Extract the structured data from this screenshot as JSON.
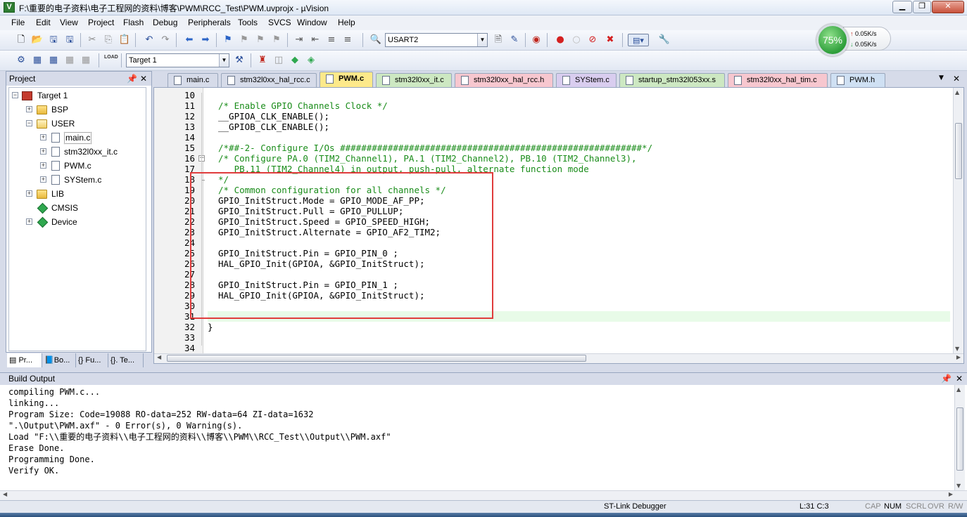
{
  "window": {
    "title": "F:\\重要的电子资料\\电子工程网的资料\\博客\\PWM\\RCC_Test\\PWM.uvprojx - µVision",
    "app_icon": "V"
  },
  "menu": [
    "File",
    "Edit",
    "View",
    "Project",
    "Flash",
    "Debug",
    "Peripherals",
    "Tools",
    "SVCS",
    "Window",
    "Help"
  ],
  "toolbar": {
    "uart_combo": "USART2",
    "target_combo": "Target 1",
    "load_label": "LOAD"
  },
  "net_meter": {
    "percent": "75%",
    "up": "0.05K/s",
    "down": "0.05K/s"
  },
  "project_panel": {
    "title": "Project",
    "tree": [
      {
        "label": "Target 1"
      },
      {
        "label": "BSP"
      },
      {
        "label": "USER"
      },
      {
        "label": "main.c"
      },
      {
        "label": "stm32l0xx_it.c"
      },
      {
        "label": "PWM.c"
      },
      {
        "label": "SYStem.c"
      },
      {
        "label": "LIB"
      },
      {
        "label": "CMSIS"
      },
      {
        "label": "Device"
      }
    ],
    "bottom_tabs": [
      "Pr...",
      "Bo...",
      "{} Fu...",
      "{}. Te..."
    ]
  },
  "editor_tabs": [
    {
      "label": "main.c",
      "color": "#d6dbe9"
    },
    {
      "label": "stm32l0xx_hal_rcc.c",
      "color": "#d6dbe9"
    },
    {
      "label": "PWM.c",
      "color": "#fde98a"
    },
    {
      "label": "stm32l0xx_it.c",
      "color": "#cde8c2"
    },
    {
      "label": "stm32l0xx_hal_rcc.h",
      "color": "#f7c7cf"
    },
    {
      "label": "SYStem.c",
      "color": "#d9cdef"
    },
    {
      "label": "startup_stm32l053xx.s",
      "color": "#cde8c2"
    },
    {
      "label": "stm32l0xx_hal_tim.c",
      "color": "#f7c7cf"
    },
    {
      "label": "PWM.h",
      "color": "#cfe0f3"
    }
  ],
  "code_lines": [
    {
      "n": "10",
      "text": ""
    },
    {
      "n": "11",
      "text": "/* Enable GPIO Channels Clock */"
    },
    {
      "n": "12",
      "text": "__GPIOA_CLK_ENABLE();"
    },
    {
      "n": "13",
      "text": "__GPIOB_CLK_ENABLE();"
    },
    {
      "n": "14",
      "text": ""
    },
    {
      "n": "15",
      "text": "/*##-2- Configure I/Os #########################################################*/"
    },
    {
      "n": "16",
      "text": "/* Configure PA.0 (TIM2_Channel1), PA.1 (TIM2_Channel2), PB.10 (TIM2_Channel3),"
    },
    {
      "n": "17",
      "text": "   PB.11 (TIM2_Channel4) in output, push-pull, alternate function mode"
    },
    {
      "n": "18",
      "text": "*/"
    },
    {
      "n": "19",
      "text": "/* Common configuration for all channels */"
    },
    {
      "n": "20",
      "text": "GPIO_InitStruct.Mode = GPIO_MODE_AF_PP;"
    },
    {
      "n": "21",
      "text": "GPIO_InitStruct.Pull = GPIO_PULLUP;"
    },
    {
      "n": "22",
      "text": "GPIO_InitStruct.Speed = GPIO_SPEED_HIGH;"
    },
    {
      "n": "23",
      "text": "GPIO_InitStruct.Alternate = GPIO_AF2_TIM2;"
    },
    {
      "n": "24",
      "text": ""
    },
    {
      "n": "25",
      "text": "GPIO_InitStruct.Pin = GPIO_PIN_0 ;"
    },
    {
      "n": "26",
      "text": "HAL_GPIO_Init(GPIOA, &GPIO_InitStruct);"
    },
    {
      "n": "27",
      "text": ""
    },
    {
      "n": "28",
      "text": "GPIO_InitStruct.Pin = GPIO_PIN_1 ;"
    },
    {
      "n": "29",
      "text": "HAL_GPIO_Init(GPIOA, &GPIO_InitStruct);"
    },
    {
      "n": "30",
      "text": ""
    },
    {
      "n": "31",
      "text": ""
    },
    {
      "n": "32",
      "text": "}"
    },
    {
      "n": "33",
      "text": ""
    },
    {
      "n": "34",
      "text": ""
    }
  ],
  "build_output": {
    "title": "Build Output",
    "lines": [
      "compiling PWM.c...",
      "linking...",
      "Program Size: Code=19088 RO-data=252 RW-data=64 ZI-data=1632",
      "\".\\Output\\PWM.axf\" - 0 Error(s), 0 Warning(s).",
      "Load \"F:\\\\重要的电子资料\\\\电子工程网的资料\\\\博客\\\\PWM\\\\RCC_Test\\\\Output\\\\PWM.axf\"",
      "Erase Done.",
      "Programming Done.",
      "Verify OK."
    ]
  },
  "status": {
    "debugger": "ST-Link Debugger",
    "position": "L:31 C:3",
    "caps": "CAP",
    "num": "NUM",
    "scrl": "SCRL",
    "ovr": "OVR",
    "rw": "R/W"
  },
  "colors": {
    "comment": "#198c19",
    "highlight_box": "#e03c3c",
    "current_line": "#e8fbe8"
  }
}
